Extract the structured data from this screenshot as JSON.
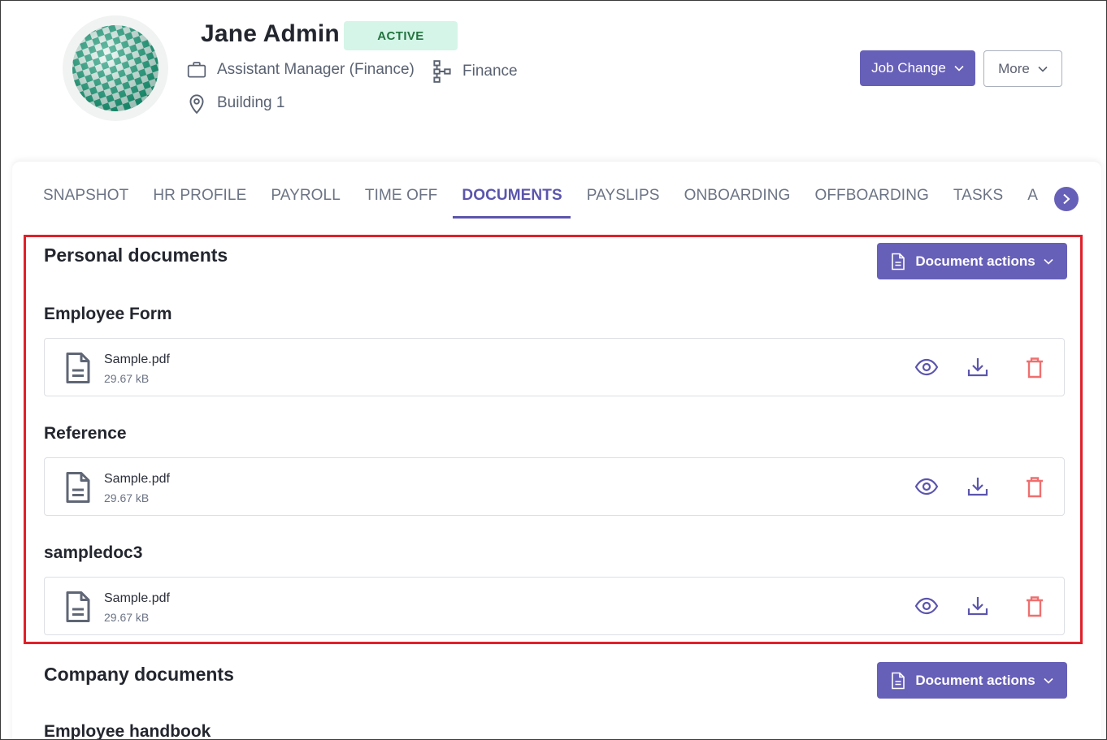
{
  "header": {
    "name": "Jane Admin",
    "status": "ACTIVE",
    "job_title": "Assistant Manager (Finance)",
    "department": "Finance",
    "location": "Building 1",
    "job_change_label": "Job Change",
    "more_label": "More"
  },
  "tabs": [
    {
      "label": "SNAPSHOT"
    },
    {
      "label": "HR PROFILE"
    },
    {
      "label": "PAYROLL"
    },
    {
      "label": "TIME OFF"
    },
    {
      "label": "DOCUMENTS",
      "active": true
    },
    {
      "label": "PAYSLIPS"
    },
    {
      "label": "ONBOARDING"
    },
    {
      "label": "OFFBOARDING"
    },
    {
      "label": "TASKS"
    },
    {
      "label": "A"
    }
  ],
  "personal": {
    "title": "Personal documents",
    "actions_label": "Document actions",
    "groups": [
      {
        "title": "Employee Form",
        "file": {
          "name": "Sample.pdf",
          "size": "29.67 kB"
        }
      },
      {
        "title": "Reference",
        "file": {
          "name": "Sample.pdf",
          "size": "29.67 kB"
        }
      },
      {
        "title": "sampledoc3",
        "file": {
          "name": "Sample.pdf",
          "size": "29.67 kB"
        }
      }
    ]
  },
  "company": {
    "title": "Company documents",
    "actions_label": "Document actions",
    "first_group_title": "Employee handbook"
  },
  "colors": {
    "primary": "#6760b8",
    "active_tab": "#5b55ad",
    "badge_bg": "#d4f5e8",
    "badge_text": "#24733f",
    "delete": "#ef6f6f",
    "highlight": "#e0202a"
  },
  "icons": [
    "briefcase-icon",
    "org-chart-icon",
    "location-pin-icon",
    "chevron-down-icon",
    "chevron-right-icon",
    "document-icon",
    "file-icon",
    "eye-icon",
    "download-icon",
    "trash-icon"
  ]
}
